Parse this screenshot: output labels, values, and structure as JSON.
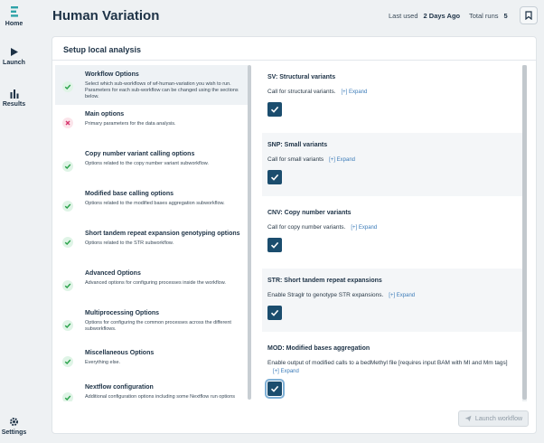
{
  "app": {
    "nav": [
      {
        "label": "Home",
        "icon": "logo-icon"
      },
      {
        "label": "Launch",
        "icon": "play-icon"
      },
      {
        "label": "Results",
        "icon": "bar-chart-icon"
      },
      {
        "label": "Settings",
        "icon": "gear-icon"
      }
    ]
  },
  "header": {
    "title": "Human Variation",
    "last_used_label": "Last used",
    "last_used_value": "2 Days Ago",
    "total_runs_label": "Total runs",
    "total_runs_value": "5",
    "bookmark_icon": "bookmark-icon"
  },
  "card": {
    "title": "Setup local analysis",
    "steps": [
      {
        "name": "Workflow Options",
        "desc": "Select which sub-workflows of wf-human-variation you wish to run. Parameters for each sub-workflow can be changed using the sections below.",
        "status": "ok"
      },
      {
        "name": "Main options",
        "desc": "Primary parameters for the data analysis.",
        "status": "error"
      },
      {
        "name": "Copy number variant calling options",
        "desc": "Options related to the copy number variant subworkflow.",
        "status": "ok"
      },
      {
        "name": "Modified base calling options",
        "desc": "Options related to the modified bases aggregation subworkflow.",
        "status": "ok"
      },
      {
        "name": "Short tandem repeat expansion genotyping options",
        "desc": "Options related to the STR subworkflow.",
        "status": "ok"
      },
      {
        "name": "Advanced Options",
        "desc": "Advanced options for configuring processes inside the workflow.",
        "status": "ok"
      },
      {
        "name": "Multiprocessing Options",
        "desc": "Options for configuring the common processes across the different subworkflows.",
        "status": "ok"
      },
      {
        "name": "Miscellaneous Options",
        "desc": "Everything else.",
        "status": "ok"
      },
      {
        "name": "Nextflow configuration",
        "desc": "Additional configuration options including some Nextflow run options",
        "status": "ok"
      }
    ],
    "options": [
      {
        "title": "SV: Structural variants",
        "desc": "Call for structural variants.",
        "expand": "[+] Expand",
        "checked": true
      },
      {
        "title": "SNP: Small variants",
        "desc": "Call for small variants",
        "expand": "[+] Expand",
        "checked": true
      },
      {
        "title": "CNV: Copy number variants",
        "desc": "Call for copy number variants.",
        "expand": "[+] Expand",
        "checked": true
      },
      {
        "title": "STR: Short tandem repeat expansions",
        "desc": "Enable Straglr to genotype STR expansions.",
        "expand": "[+] Expand",
        "checked": true
      },
      {
        "title": "MOD: Modified bases aggregation",
        "desc": "Enable output of modified calls to a bedMethyl file [requires input BAM with MI and Mm tags]",
        "expand": "[+] Expand",
        "checked": true
      }
    ],
    "launch_label": "Launch workflow"
  },
  "colors": {
    "accent": "#1b4d6e",
    "ok": "#2aa24a",
    "error": "#d6336c",
    "link": "#3b7bb8"
  }
}
